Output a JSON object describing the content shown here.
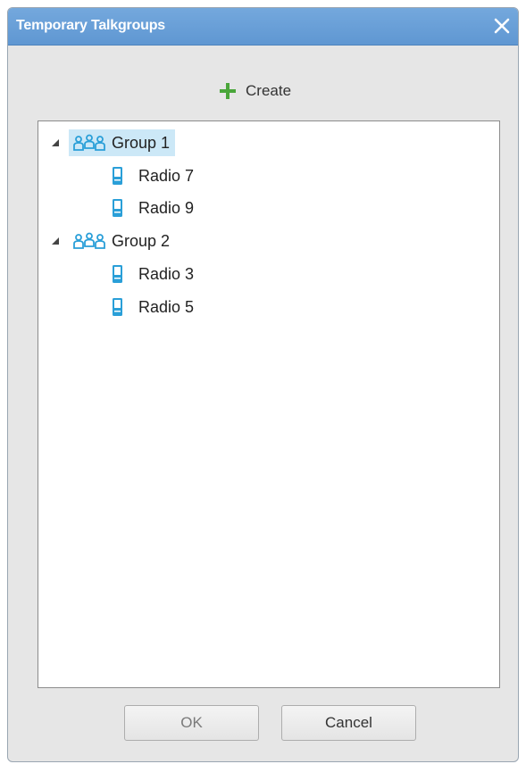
{
  "window": {
    "title": "Temporary Talkgroups"
  },
  "toolbar": {
    "create_label": "Create",
    "create_icon": "plus-icon"
  },
  "tree": {
    "groups": [
      {
        "label": "Group 1",
        "icon": "group-icon",
        "expanded": true,
        "selected": true,
        "radios": [
          {
            "label": "Radio 7",
            "icon": "radio-icon"
          },
          {
            "label": "Radio 9",
            "icon": "radio-icon"
          }
        ]
      },
      {
        "label": "Group 2",
        "icon": "group-icon",
        "expanded": true,
        "selected": false,
        "radios": [
          {
            "label": "Radio 3",
            "icon": "radio-icon"
          },
          {
            "label": "Radio 5",
            "icon": "radio-icon"
          }
        ]
      }
    ]
  },
  "buttons": {
    "ok_label": "OK",
    "cancel_label": "Cancel"
  },
  "colors": {
    "titlebar": "#6aa1da",
    "selection": "#cce8f7",
    "icon_blue": "#2a9fd8",
    "plus_green": "#4aa63a"
  }
}
